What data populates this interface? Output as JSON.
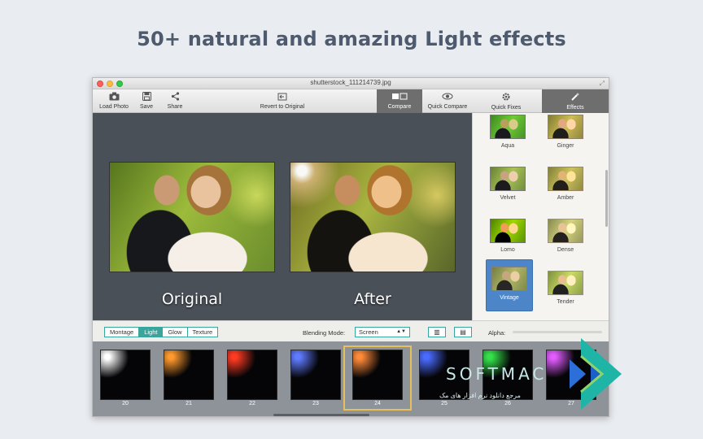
{
  "headline": "50+ natural and amazing Light effects",
  "window": {
    "title": "shutterstock_111214739.jpg"
  },
  "toolbar": {
    "load_photo": "Load Photo",
    "save": "Save",
    "share": "Share",
    "revert": "Revert to Original",
    "compare": "Compare",
    "quick_compare": "Quick Compare",
    "quick_fixes": "Quick Fixes",
    "effects": "Effects"
  },
  "canvas": {
    "original_caption": "Original",
    "after_caption": "After"
  },
  "effects_panel": {
    "items": [
      {
        "label": "Aqua",
        "filter": "aqua"
      },
      {
        "label": "Ginger",
        "filter": "ginger"
      },
      {
        "label": "Velvet",
        "filter": "velvet"
      },
      {
        "label": "Amber",
        "filter": "amber"
      },
      {
        "label": "Lomo",
        "filter": "lomo"
      },
      {
        "label": "Dense",
        "filter": "dense"
      },
      {
        "label": "Vintage",
        "filter": "vintage"
      },
      {
        "label": "Tender",
        "filter": "tender"
      }
    ],
    "selected": "Vintage"
  },
  "controls": {
    "tabs": [
      "Montage",
      "Light",
      "Glow",
      "Texture"
    ],
    "active_tab": "Light",
    "blending_label": "Blending Mode:",
    "blending_value": "Screen",
    "alpha_label": "Alpha:"
  },
  "filmstrip": {
    "items": [
      {
        "num": "20",
        "light": "#ffffff"
      },
      {
        "num": "21",
        "light": "#ff9a2e"
      },
      {
        "num": "22",
        "light": "#ff3a22"
      },
      {
        "num": "23",
        "light": "#5f7bff"
      },
      {
        "num": "24",
        "light": "#ff8a3a"
      },
      {
        "num": "25",
        "light": "#4a6bff"
      },
      {
        "num": "26",
        "light": "#35e04a"
      },
      {
        "num": "27",
        "light": "#e25cff"
      }
    ],
    "selected": "24"
  },
  "watermark": {
    "brand": "SOFTMAC",
    "tagline": "مرجع دانلود نرم افزار های مک"
  },
  "colors": {
    "accent": "#3aa59d",
    "selection": "#4c86c8",
    "canvas": "#4a5058",
    "headline": "#4e5a6e"
  }
}
